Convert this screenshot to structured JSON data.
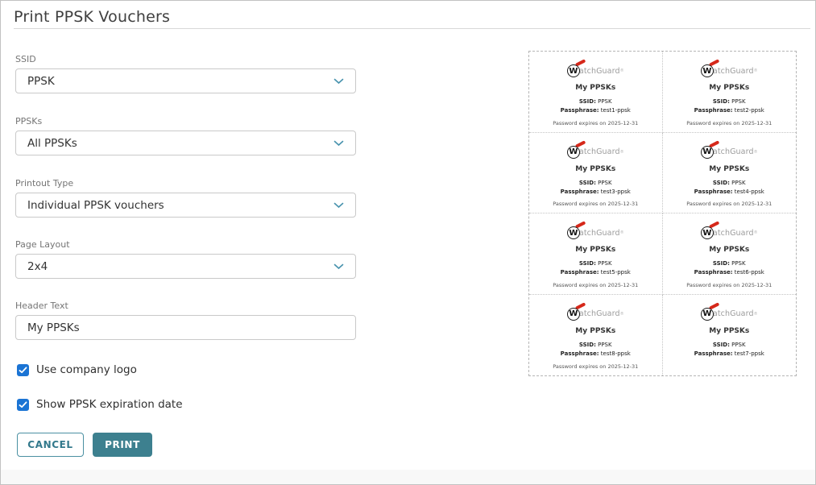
{
  "page": {
    "title": "Print PPSK Vouchers"
  },
  "form": {
    "fields": [
      {
        "label": "SSID",
        "value": "PPSK"
      },
      {
        "label": "PPSKs",
        "value": "All PPSKs"
      },
      {
        "label": "Printout Type",
        "value": "Individual PPSK vouchers"
      },
      {
        "label": "Page Layout",
        "value": "2x4"
      },
      {
        "label": "Header Text",
        "value": "My PPSKs"
      }
    ],
    "checkboxes": [
      {
        "label": "Use company logo",
        "checked": true
      },
      {
        "label": "Show PPSK expiration date",
        "checked": true
      }
    ],
    "buttons": {
      "cancel": "CANCEL",
      "print": "PRINT"
    }
  },
  "preview": {
    "brand": {
      "initial": "W",
      "rest": "atchGuard",
      "registered": "®"
    },
    "header_text": "My PPSKs",
    "ssid_label": "SSID:",
    "ssid_value": "PPSK",
    "passphrase_label": "Passphrase:",
    "expiry_text": "Password expires on 2025-12-31",
    "layout": "2x4",
    "vouchers": [
      {
        "passphrase": "test1-ppsk",
        "show_expiry": true
      },
      {
        "passphrase": "test2-ppsk",
        "show_expiry": true
      },
      {
        "passphrase": "test3-ppsk",
        "show_expiry": true
      },
      {
        "passphrase": "test4-ppsk",
        "show_expiry": true
      },
      {
        "passphrase": "test5-ppsk",
        "show_expiry": true
      },
      {
        "passphrase": "test6-ppsk",
        "show_expiry": true
      },
      {
        "passphrase": "test8-ppsk",
        "show_expiry": true
      },
      {
        "passphrase": "test7-ppsk",
        "show_expiry": false
      }
    ]
  },
  "colors": {
    "accent_teal": "#3d808f",
    "checkbox_blue": "#1b74d4",
    "brand_red": "#d6281a",
    "chevron_blue": "#4792ad"
  }
}
